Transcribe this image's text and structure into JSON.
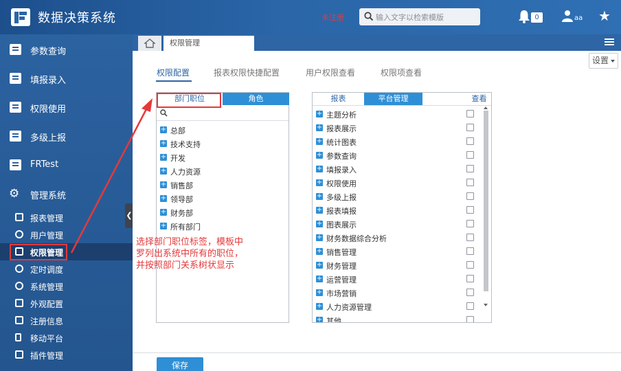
{
  "header": {
    "app_title": "数据决策系统",
    "unregistered": "未注册",
    "search_placeholder": "输入文字以检索模版",
    "notification_count": "0",
    "user_name": "aa"
  },
  "sidebar": {
    "items": [
      {
        "label": "参数查询"
      },
      {
        "label": "填报录入"
      },
      {
        "label": "权限使用"
      },
      {
        "label": "多级上报"
      },
      {
        "label": "FRTest"
      },
      {
        "label": "管理系统"
      }
    ],
    "subitems": [
      {
        "label": "报表管理"
      },
      {
        "label": "用户管理"
      },
      {
        "label": "权限管理"
      },
      {
        "label": "定时调度"
      },
      {
        "label": "系统管理"
      },
      {
        "label": "外观配置"
      },
      {
        "label": "注册信息"
      },
      {
        "label": "移动平台"
      },
      {
        "label": "插件管理"
      }
    ]
  },
  "tabs": {
    "page_tab": "权限管理",
    "settings": "设置"
  },
  "subtabs": [
    "权限配置",
    "报表权限快捷配置",
    "用户权限查看",
    "权限项查看"
  ],
  "left_panel": {
    "tab_dept": "部门职位",
    "tab_role": "角色",
    "tree": [
      "总部",
      "技术支持",
      "开发",
      "人力资源",
      "销售部",
      "领导部",
      "财务部",
      "所有部门"
    ]
  },
  "right_panel": {
    "tab_report": "报表",
    "tab_platform": "平台管理",
    "view_label": "查看",
    "items": [
      "主题分析",
      "报表展示",
      "统计图表",
      "参数查询",
      "填报录入",
      "权限使用",
      "多级上报",
      "报表填报",
      "图表展示",
      "财务数据综合分析",
      "销售管理",
      "财务管理",
      "运营管理",
      "市场营销",
      "人力资源管理",
      "其他"
    ]
  },
  "save_label": "保存",
  "annotation": {
    "line1": "选择部门职位标签，模板中",
    "line2": "罗列出系统中所有的职位，",
    "line3": "并按照部门关系树状显示"
  },
  "colors": {
    "primary": "#2e65a5",
    "accent": "#2e8fd6",
    "annotation": "#e5393a"
  }
}
